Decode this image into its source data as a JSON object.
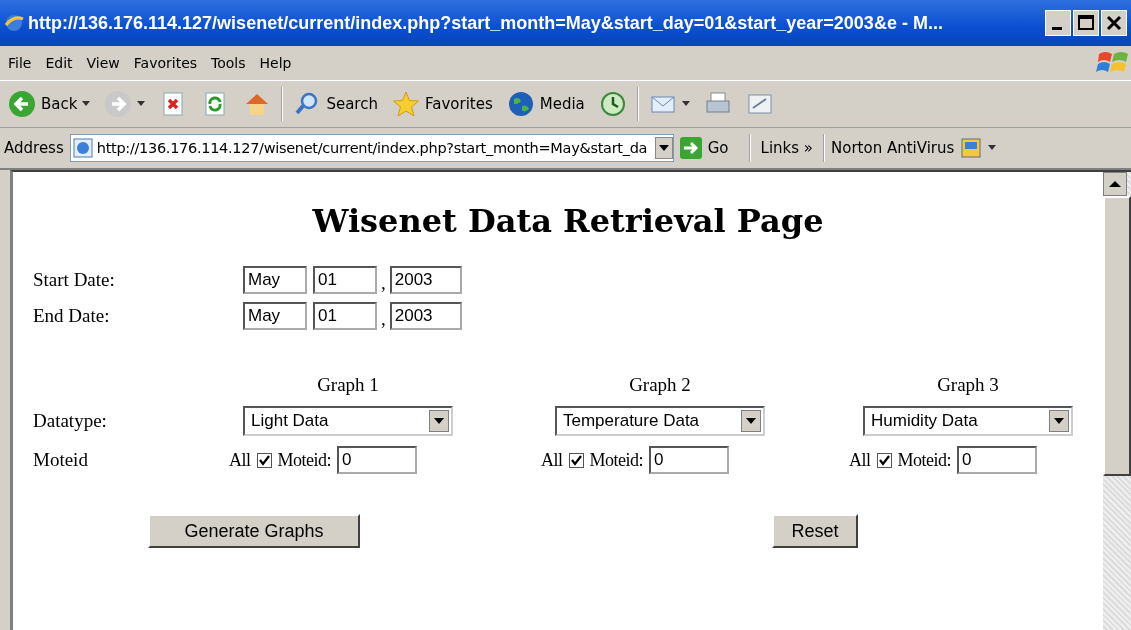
{
  "window": {
    "title": "http://136.176.114.127/wisenet/current/index.php?start_month=May&start_day=01&start_year=2003&e - M..."
  },
  "menu": [
    "File",
    "Edit",
    "View",
    "Favorites",
    "Tools",
    "Help"
  ],
  "toolbar": [
    {
      "kind": "back",
      "label": "Back"
    },
    {
      "kind": "forward"
    },
    {
      "kind": "stop"
    },
    {
      "kind": "refresh"
    },
    {
      "kind": "home"
    },
    {
      "kind": "search",
      "label": "Search"
    },
    {
      "kind": "favorites",
      "label": "Favorites"
    },
    {
      "kind": "media",
      "label": "Media"
    },
    {
      "kind": "history"
    },
    {
      "kind": "mail"
    },
    {
      "kind": "print"
    },
    {
      "kind": "edit"
    }
  ],
  "address_bar": {
    "label": "Address",
    "url": "http://136.176.114.127/wisenet/current/index.php?start_month=May&start_da",
    "go": "Go",
    "links": "Links",
    "links_chevron": "»",
    "norton": "Norton AntiVirus"
  },
  "page": {
    "heading": "Wisenet Data Retrieval Page",
    "dates": [
      {
        "label": "Start Date:",
        "month": "May",
        "day": "01",
        "separator": ",",
        "year": "2003"
      },
      {
        "label": "End Date:",
        "month": "May",
        "day": "01",
        "separator": ",",
        "year": "2003"
      }
    ],
    "datatype_label": "Datatype:",
    "moteid_label": "Moteid",
    "graphs": [
      {
        "heading": "Graph 1",
        "datatype": "Light Data",
        "all_label": "All",
        "all_checked": true,
        "moteid_label": "Moteid:",
        "moteid": "0"
      },
      {
        "heading": "Graph 2",
        "datatype": "Temperature Data",
        "all_label": "All",
        "all_checked": true,
        "moteid_label": "Moteid:",
        "moteid": "0"
      },
      {
        "heading": "Graph 3",
        "datatype": "Humidity Data",
        "all_label": "All",
        "all_checked": true,
        "moteid_label": "Moteid:",
        "moteid": "0"
      }
    ],
    "buttons": [
      "Generate Graphs",
      "Reset"
    ]
  }
}
